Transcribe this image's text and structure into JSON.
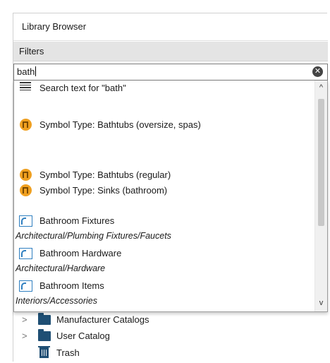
{
  "window": {
    "title": "Library Browser"
  },
  "filters": {
    "label": "Filters"
  },
  "search": {
    "value": "bath",
    "clear_label": "✕"
  },
  "suggestions": [
    {
      "kind": "text",
      "icon": "search-text-icon",
      "label": "Search text for \"bath\""
    },
    {
      "kind": "symbol",
      "icon": "symbol-type-icon",
      "label": "Symbol Type: Bathtubs (oversize, spas)"
    },
    {
      "kind": "symbol",
      "icon": "symbol-type-icon",
      "label": "Symbol Type: Bathtubs (regular)"
    },
    {
      "kind": "symbol",
      "icon": "symbol-type-icon",
      "label": "Symbol Type: Sinks (bathroom)"
    },
    {
      "kind": "folder",
      "icon": "library-folder-icon",
      "label": "Bathroom Fixtures",
      "path": "Architectural/Plumbing Fixtures/Faucets"
    },
    {
      "kind": "folder",
      "icon": "library-folder-icon",
      "label": "Bathroom Hardware",
      "path": "Architectural/Hardware"
    },
    {
      "kind": "folder",
      "icon": "library-folder-icon",
      "label": "Bathroom Items",
      "path": "Interiors/Accessories"
    }
  ],
  "scrollbar": {
    "up_arrow": "^",
    "down_arrow": "v"
  },
  "tree": [
    {
      "label": "Manufacturer Catalogs",
      "icon": "folder-icon",
      "expandable": true
    },
    {
      "label": "User Catalog",
      "icon": "folder-icon",
      "expandable": true
    },
    {
      "label": "Trash",
      "icon": "trash-icon",
      "expandable": false
    }
  ],
  "tree_chevron": ">",
  "colors": {
    "symbol_icon": "#f0a020",
    "folder_icon": "#2f7fc0",
    "tree_icon": "#1f4f74"
  }
}
